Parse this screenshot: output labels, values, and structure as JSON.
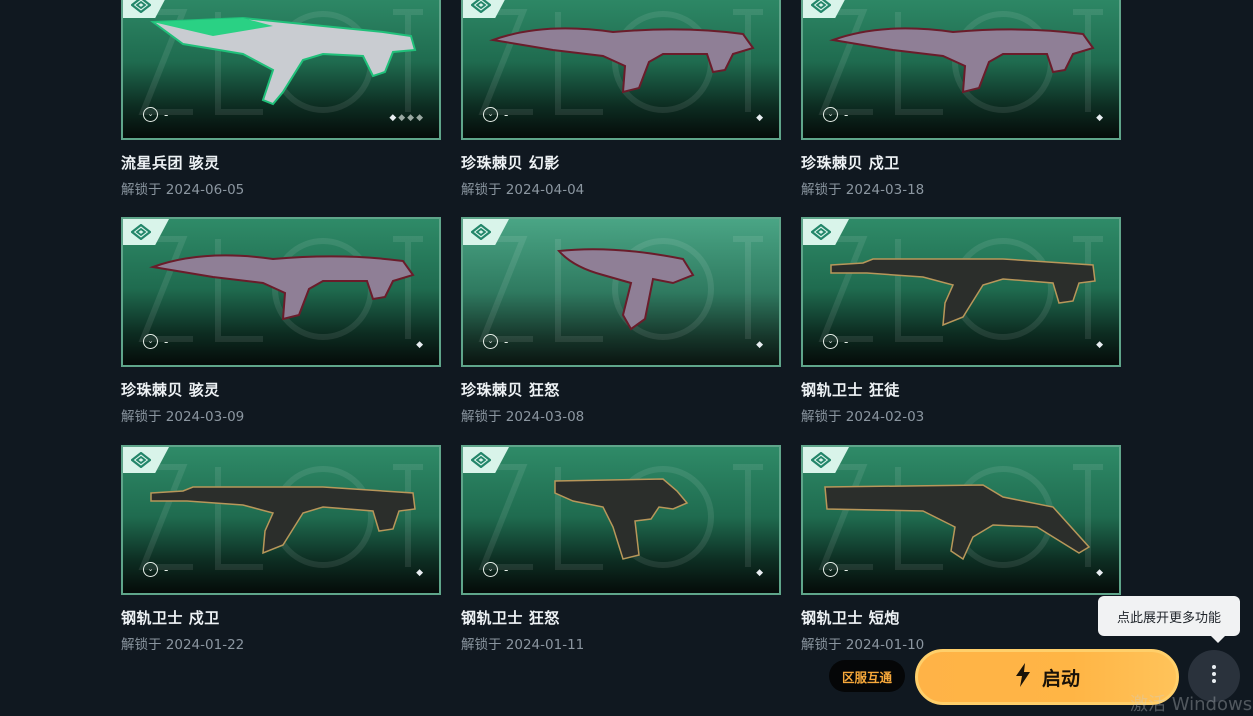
{
  "skins": [
    {
      "name": "流星兵团 骇灵",
      "date": "解锁于 2024-06-05",
      "level": "-",
      "variant": "meteor",
      "dots": 4
    },
    {
      "name": "珍珠棘贝 幻影",
      "date": "解锁于 2024-04-04",
      "level": "-",
      "variant": "pearl",
      "dots": 1
    },
    {
      "name": "珍珠棘贝 戍卫",
      "date": "解锁于 2024-03-18",
      "level": "-",
      "variant": "pearl",
      "dots": 1
    },
    {
      "name": "珍珠棘贝 骇灵",
      "date": "解锁于 2024-03-09",
      "level": "-",
      "variant": "pearl",
      "dots": 1
    },
    {
      "name": "珍珠棘贝 狂怒",
      "date": "解锁于 2024-03-08",
      "level": "-",
      "variant": "pearl-pistol",
      "dots": 1
    },
    {
      "name": "钢轨卫士 狂徒",
      "date": "解锁于 2024-02-03",
      "level": "-",
      "variant": "rail",
      "dots": 1
    },
    {
      "name": "钢轨卫士 戍卫",
      "date": "解锁于 2024-01-22",
      "level": "-",
      "variant": "rail",
      "dots": 1
    },
    {
      "name": "钢轨卫士 狂怒",
      "date": "解锁于 2024-01-11",
      "level": "-",
      "variant": "rail-pistol",
      "dots": 1
    },
    {
      "name": "钢轨卫士 短炮",
      "date": "解锁于 2024-01-10",
      "level": "-",
      "variant": "rail-shorty",
      "dots": 1
    }
  ],
  "footer": {
    "region_label": "区服互通",
    "launch_label": "启动",
    "tooltip": "点此展开更多功能",
    "more_icon": "more-vertical-icon",
    "launch_icon": "lightning-icon"
  },
  "watermark_text": "激活 Windows",
  "colors": {
    "accent": "#ffb347",
    "card_border": "#5fa58a",
    "tag_bg": "#d9f4ea",
    "region_text": "#f7a83a"
  }
}
